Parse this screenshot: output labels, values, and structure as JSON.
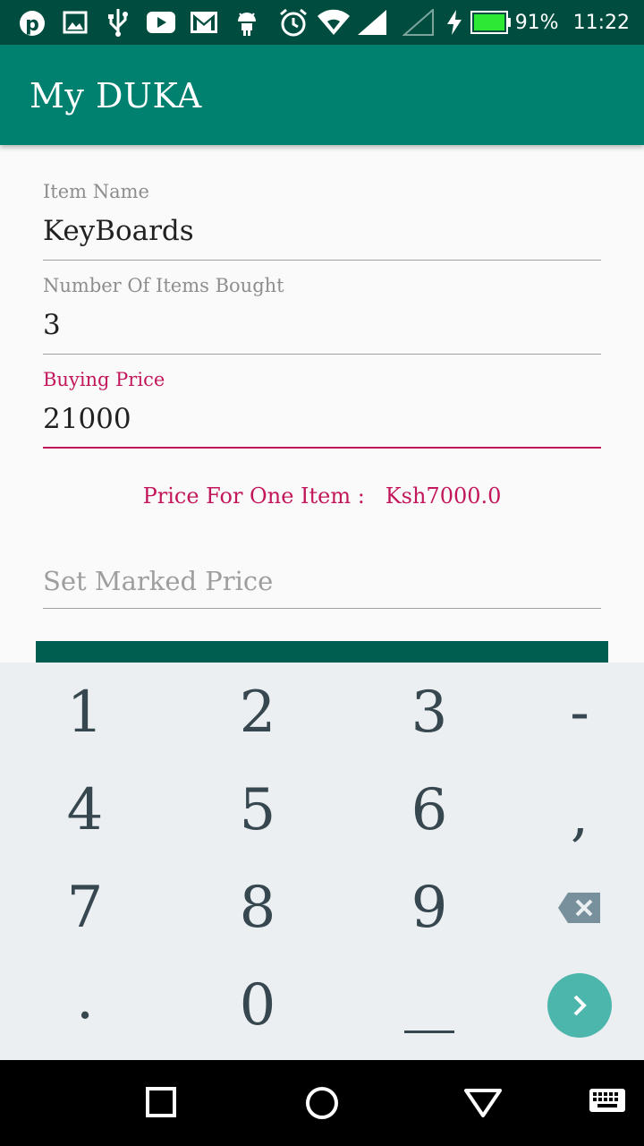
{
  "status_bar": {
    "battery": "91%",
    "time": "11:22",
    "icons": [
      "pinterest-icon",
      "image-icon",
      "usb-icon",
      "youtube-icon",
      "gmail-icon",
      "android-icon",
      "alarm-icon",
      "wifi-icon",
      "signal-icon",
      "signal-empty-icon",
      "charging-icon",
      "battery-icon"
    ]
  },
  "app_bar": {
    "title": "My DUKA"
  },
  "form": {
    "item_name": {
      "label": "Item Name",
      "value": "KeyBoards"
    },
    "items_bought": {
      "label": "Number Of Items Bought",
      "value": "3"
    },
    "buying_price": {
      "label": "Buying Price",
      "value": "21000"
    },
    "price_one_item": {
      "label": "Price For One Item :",
      "value": "Ksh7000.0"
    },
    "marked_price": {
      "placeholder": "Set Marked Price",
      "value": ""
    }
  },
  "keyboard": {
    "keys": [
      "1",
      "2",
      "3",
      "-",
      "4",
      "5",
      "6",
      ",",
      "7",
      "8",
      "9",
      ".",
      "0",
      "_"
    ]
  },
  "colors": {
    "app_bar": "#00806f",
    "status_bar": "#004d40",
    "accent": "#c2185b",
    "enter": "#4db6ac",
    "button": "#005e50"
  }
}
